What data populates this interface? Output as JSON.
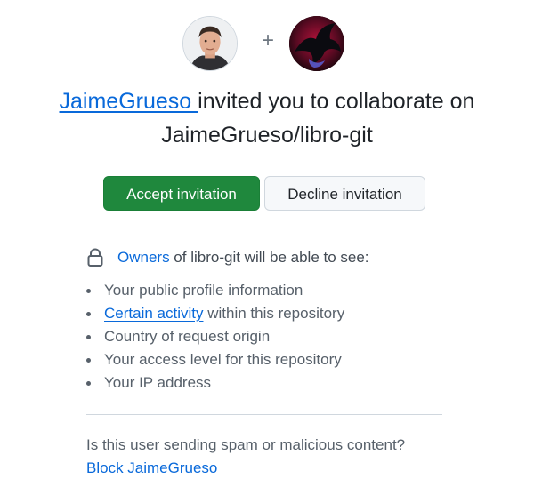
{
  "inviter": {
    "username": "JaimeGrueso ",
    "avatar_alt": "JaimeGrueso avatar"
  },
  "plus_symbol": "+",
  "title": {
    "text_after_user": " invited you to collaborate on",
    "repo_full_name": "JaimeGrueso/libro-git"
  },
  "buttons": {
    "accept_label": "Accept invitation",
    "decline_label": "Decline invitation"
  },
  "permissions": {
    "owners_link": "Owners",
    "owners_suffix": " of libro-git will be able to see:",
    "items": [
      {
        "text": "Your public profile information"
      },
      {
        "link": "Certain activity",
        "text": " within this repository"
      },
      {
        "text": "Country of request origin"
      },
      {
        "text": "Your access level for this repository"
      },
      {
        "text": "Your IP address"
      }
    ]
  },
  "report": {
    "question": "Is this user sending spam or malicious content?",
    "block_link": "Block JaimeGrueso"
  },
  "icons": {
    "lock": "lock-icon",
    "plus": "plus-icon"
  },
  "colors": {
    "accent_link": "#0969da",
    "accept_green": "#1f883d",
    "text_primary": "#1f2328",
    "text_muted": "#57606a",
    "border": "#d0d7de"
  }
}
